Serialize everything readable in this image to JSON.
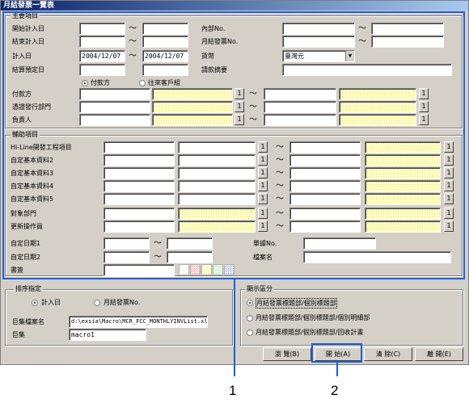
{
  "window": {
    "title": "月結發票一覽表"
  },
  "main_group": {
    "title": "主要項目",
    "start_date_label": "開始計入日",
    "end_date_label": "結束計入日",
    "calc_date_label": "計入日",
    "calc_date_from": "2004/12/07",
    "calc_date_to": "2004/12/07",
    "settle_date_label": "結算預定日",
    "internal_no_label": "內部No.",
    "monthly_invoice_no_label": "月結發票No.",
    "currency_label": "貨幣",
    "currency_value": "臺灣元",
    "invoice_summary_label": "請款摘要",
    "radio_payer": "付款方",
    "radio_customer": "往來客戶組",
    "payer_label": "付款方",
    "voucher_dept_label": "憑證發行部門",
    "person_label": "負責人",
    "tilde": "～",
    "lookup": "1"
  },
  "aux_group": {
    "title": "輔助項目",
    "rows": [
      "Hi-Line開發工程項目",
      "自定基本資料2",
      "自定基本資料3",
      "自定基本資料4",
      "自定基本資料5",
      "對象部門",
      "更新操作員"
    ],
    "custom_date1_label": "自定日期1",
    "custom_date2_label": "自定日期2",
    "memo_label": "書簽",
    "page_no_label": "單據No.",
    "file_name_label": "檔案名"
  },
  "sort_group": {
    "title": "排序指定",
    "option_calc_date": "計入日",
    "option_invoice_no": "月結發票No.",
    "file_label": "巨集檔案名",
    "file_value": "d:\\exsia\\Macro\\MCR_FCC_MONTHLYINVList.xls",
    "macro_label": "巨集",
    "macro_value": "macro1"
  },
  "display_group": {
    "title": "顯示區分",
    "option1": "月結發票標題部/個別標題部",
    "option2": "月結發票標題部/個別標題部/個別明細部",
    "option3": "月結發票標題部/個別標題部/回收計畫"
  },
  "buttons": {
    "preview": "瀏 覽(B)",
    "start": "開 始(A)",
    "clear": "清 除(C)",
    "close": "離 開(E)"
  },
  "callouts": {
    "one": "1",
    "two": "2"
  },
  "colors": {
    "highlight": "#1f5fd6",
    "yellow_field": "#ffffc0"
  }
}
